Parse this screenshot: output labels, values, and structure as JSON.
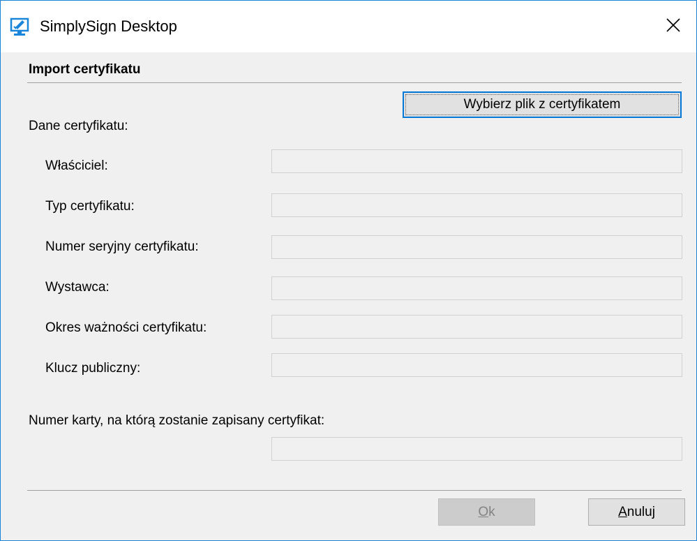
{
  "window": {
    "title": "SimplySign Desktop",
    "accent_color": "#0078d7",
    "icon": "monitor-sign-icon"
  },
  "section": {
    "title": "Import certyfikatu"
  },
  "choose_file_button": {
    "label": "Wybierz plik z certyfikatem"
  },
  "certificate": {
    "heading": "Dane certyfikatu:",
    "fields": [
      {
        "label": "Właściciel:",
        "value": ""
      },
      {
        "label": "Typ certyfikatu:",
        "value": ""
      },
      {
        "label": "Numer seryjny certyfikatu:",
        "value": ""
      },
      {
        "label": "Wystawca:",
        "value": ""
      },
      {
        "label": "Okres ważności certyfikatu:",
        "value": ""
      },
      {
        "label": "Klucz publiczny:",
        "value": ""
      }
    ]
  },
  "card_number": {
    "label": "Numer karty, na którą zostanie zapisany certyfikat:",
    "value": ""
  },
  "buttons": {
    "ok": {
      "mnemonic": "O",
      "rest": "k",
      "enabled": false
    },
    "cancel": {
      "mnemonic": "A",
      "rest": "nuluj",
      "enabled": true
    }
  }
}
